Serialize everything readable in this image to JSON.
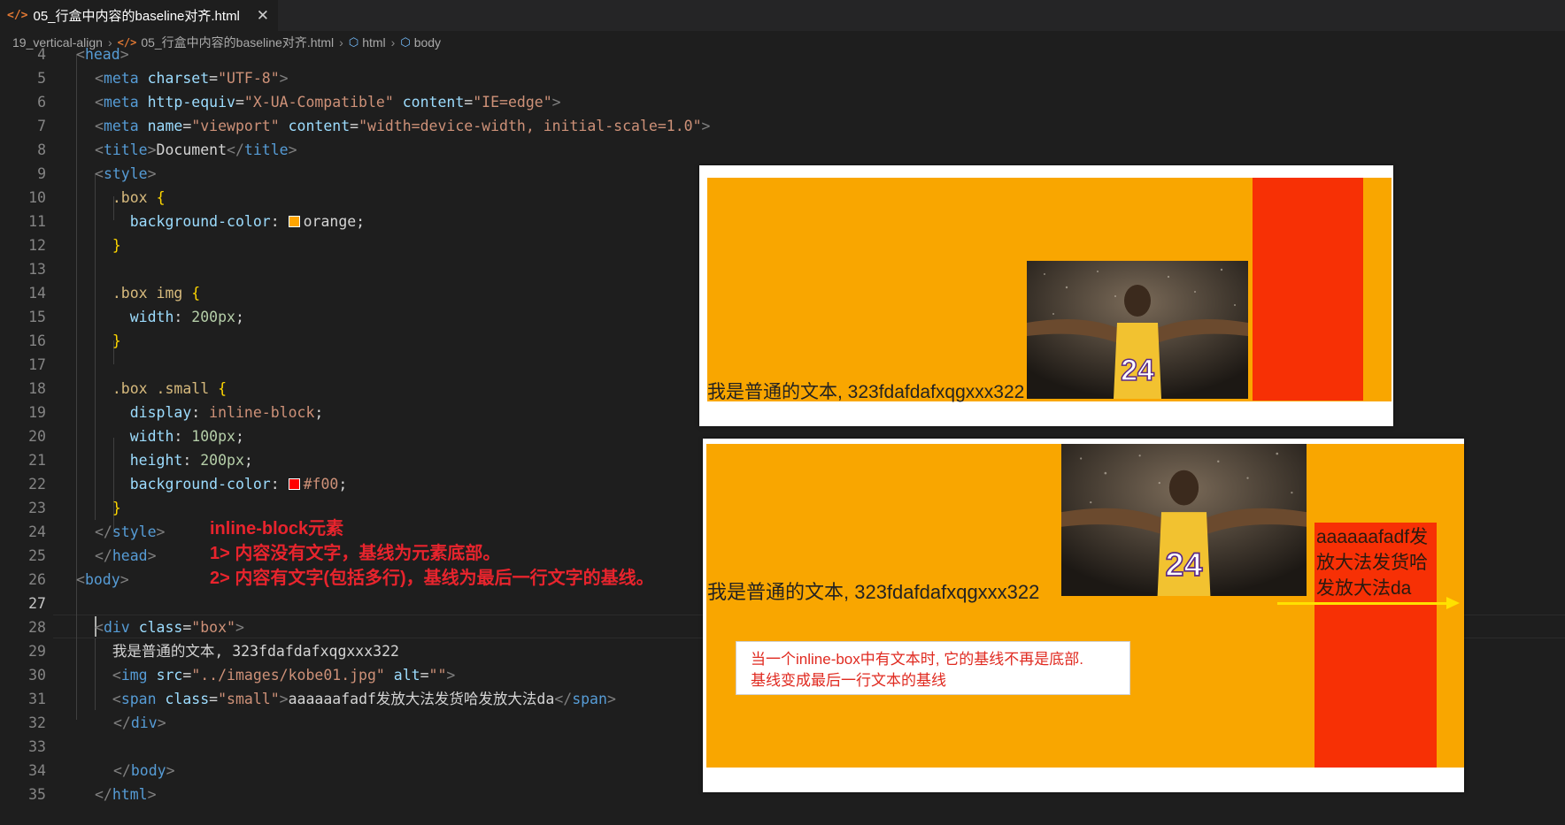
{
  "tab": {
    "icon": "</>",
    "title": "05_行盒中内容的baseline对齐.html",
    "close": "✕"
  },
  "breadcrumb": {
    "folder": "19_vertical-align",
    "file": "05_行盒中内容的baseline对齐.html",
    "html": "html",
    "body": "body"
  },
  "code_lines": [
    {
      "n": "4",
      "tokens": [
        [
          "t-br",
          "<"
        ],
        [
          "t-tag",
          "head"
        ],
        [
          "t-br",
          ">"
        ]
      ]
    },
    {
      "n": "5",
      "tokens": [
        [
          "t-br",
          "<"
        ],
        [
          "t-tag",
          "meta"
        ],
        [
          "t-text",
          " "
        ],
        [
          "t-attr",
          "charset"
        ],
        [
          "t-text",
          "="
        ],
        [
          "t-str",
          "\"UTF-8\""
        ],
        [
          "t-br",
          ">"
        ]
      ]
    },
    {
      "n": "6",
      "tokens": [
        [
          "t-br",
          "<"
        ],
        [
          "t-tag",
          "meta"
        ],
        [
          "t-text",
          " "
        ],
        [
          "t-attr",
          "http-equiv"
        ],
        [
          "t-text",
          "="
        ],
        [
          "t-str",
          "\"X-UA-Compatible\""
        ],
        [
          "t-text",
          " "
        ],
        [
          "t-attr",
          "content"
        ],
        [
          "t-text",
          "="
        ],
        [
          "t-str",
          "\"IE=edge\""
        ],
        [
          "t-br",
          ">"
        ]
      ]
    },
    {
      "n": "7",
      "tokens": [
        [
          "t-br",
          "<"
        ],
        [
          "t-tag",
          "meta"
        ],
        [
          "t-text",
          " "
        ],
        [
          "t-attr",
          "name"
        ],
        [
          "t-text",
          "="
        ],
        [
          "t-str",
          "\"viewport\""
        ],
        [
          "t-text",
          " "
        ],
        [
          "t-attr",
          "content"
        ],
        [
          "t-text",
          "="
        ],
        [
          "t-str",
          "\"width=device-width, initial-scale=1.0\""
        ],
        [
          "t-br",
          ">"
        ]
      ]
    },
    {
      "n": "8",
      "tokens": [
        [
          "t-br",
          "<"
        ],
        [
          "t-tag",
          "title"
        ],
        [
          "t-br",
          ">"
        ],
        [
          "t-text",
          "Document"
        ],
        [
          "t-br",
          "</"
        ],
        [
          "t-tag",
          "title"
        ],
        [
          "t-br",
          ">"
        ]
      ]
    },
    {
      "n": "9",
      "tokens": [
        [
          "t-br",
          "<"
        ],
        [
          "t-tag",
          "style"
        ],
        [
          "t-br",
          ">"
        ]
      ]
    },
    {
      "n": "10",
      "tokens": [
        [
          "t-text",
          "  "
        ],
        [
          "t-sel",
          ".box"
        ],
        [
          "t-text",
          " "
        ],
        [
          "t-brace",
          "{"
        ]
      ]
    },
    {
      "n": "11",
      "tokens": [
        [
          "t-text",
          "    "
        ],
        [
          "t-prop",
          "background-color"
        ],
        [
          "t-text",
          ": "
        ],
        [
          "swatch",
          "#ffa500"
        ],
        [
          "t-text",
          "orange;"
        ]
      ]
    },
    {
      "n": "12",
      "tokens": [
        [
          "t-text",
          "  "
        ],
        [
          "t-brace",
          "}"
        ]
      ]
    },
    {
      "n": "13",
      "tokens": []
    },
    {
      "n": "14",
      "tokens": [
        [
          "t-text",
          "  "
        ],
        [
          "t-sel",
          ".box img"
        ],
        [
          "t-text",
          " "
        ],
        [
          "t-brace",
          "{"
        ]
      ]
    },
    {
      "n": "15",
      "tokens": [
        [
          "t-text",
          "    "
        ],
        [
          "t-prop",
          "width"
        ],
        [
          "t-text",
          ": "
        ],
        [
          "t-num",
          "200px"
        ],
        [
          "t-text",
          ";"
        ]
      ]
    },
    {
      "n": "16",
      "tokens": [
        [
          "t-text",
          "  "
        ],
        [
          "t-brace",
          "}"
        ]
      ]
    },
    {
      "n": "17",
      "tokens": []
    },
    {
      "n": "18",
      "tokens": [
        [
          "t-text",
          "  "
        ],
        [
          "t-sel",
          ".box .small"
        ],
        [
          "t-text",
          " "
        ],
        [
          "t-brace",
          "{"
        ]
      ]
    },
    {
      "n": "19",
      "tokens": [
        [
          "t-text",
          "    "
        ],
        [
          "t-prop",
          "display"
        ],
        [
          "t-text",
          ": "
        ],
        [
          "t-str",
          "inline-block"
        ],
        [
          "t-text",
          ";"
        ]
      ]
    },
    {
      "n": "20",
      "tokens": [
        [
          "t-text",
          "    "
        ],
        [
          "t-prop",
          "width"
        ],
        [
          "t-text",
          ": "
        ],
        [
          "t-num",
          "100px"
        ],
        [
          "t-text",
          ";"
        ]
      ]
    },
    {
      "n": "21",
      "tokens": [
        [
          "t-text",
          "    "
        ],
        [
          "t-prop",
          "height"
        ],
        [
          "t-text",
          ": "
        ],
        [
          "t-num",
          "200px"
        ],
        [
          "t-text",
          ";"
        ]
      ]
    },
    {
      "n": "22",
      "tokens": [
        [
          "t-text",
          "    "
        ],
        [
          "t-prop",
          "background-color"
        ],
        [
          "t-text",
          ": "
        ],
        [
          "swatch",
          "#ff0000"
        ],
        [
          "t-str",
          "#f00"
        ],
        [
          "t-text",
          ";"
        ]
      ]
    },
    {
      "n": "23",
      "tokens": [
        [
          "t-text",
          "  "
        ],
        [
          "t-brace",
          "}"
        ]
      ]
    },
    {
      "n": "24",
      "tokens": [
        [
          "t-br",
          "</"
        ],
        [
          "t-tag",
          "style"
        ],
        [
          "t-br",
          ">"
        ]
      ]
    },
    {
      "n": "25",
      "tokens": [
        [
          "t-br",
          "</"
        ],
        [
          "t-tag",
          "head"
        ],
        [
          "t-br",
          ">"
        ]
      ]
    },
    {
      "n": "26",
      "tokens": [
        [
          "t-br",
          "<"
        ],
        [
          "t-tag",
          "body"
        ],
        [
          "t-br",
          ">"
        ]
      ]
    },
    {
      "n": "27",
      "tokens": []
    },
    {
      "n": "28",
      "tokens": [
        [
          "t-br",
          "<"
        ],
        [
          "t-tag",
          "div"
        ],
        [
          "t-text",
          " "
        ],
        [
          "t-attr",
          "class"
        ],
        [
          "t-text",
          "="
        ],
        [
          "t-str",
          "\"box\""
        ],
        [
          "t-br",
          ">"
        ]
      ]
    },
    {
      "n": "29",
      "tokens": [
        [
          "t-text",
          "  我是普通的文本, 323fdafdafxqgxxx322"
        ]
      ]
    },
    {
      "n": "30",
      "tokens": [
        [
          "t-text",
          "  "
        ],
        [
          "t-br",
          "<"
        ],
        [
          "t-tag",
          "img"
        ],
        [
          "t-text",
          " "
        ],
        [
          "t-attr",
          "src"
        ],
        [
          "t-text",
          "="
        ],
        [
          "t-str",
          "\"../images/kobe01.jpg\""
        ],
        [
          "t-text",
          " "
        ],
        [
          "t-attr",
          "alt"
        ],
        [
          "t-text",
          "="
        ],
        [
          "t-str",
          "\"\""
        ],
        [
          "t-br",
          ">"
        ]
      ]
    },
    {
      "n": "31",
      "tokens": [
        [
          "t-text",
          "  "
        ],
        [
          "t-br",
          "<"
        ],
        [
          "t-tag",
          "span"
        ],
        [
          "t-text",
          " "
        ],
        [
          "t-attr",
          "class"
        ],
        [
          "t-text",
          "="
        ],
        [
          "t-str",
          "\"small\""
        ],
        [
          "t-br",
          ">"
        ],
        [
          "t-text",
          "aaaaaafadf发放大法发货哈发放大法da"
        ],
        [
          "t-br",
          "</"
        ],
        [
          "t-tag",
          "span"
        ],
        [
          "t-br",
          ">"
        ]
      ]
    },
    {
      "n": "32",
      "tokens": [
        [
          "t-br",
          "</"
        ],
        [
          "t-tag",
          "div"
        ],
        [
          "t-br",
          ">"
        ]
      ]
    },
    {
      "n": "33",
      "tokens": []
    },
    {
      "n": "34",
      "tokens": [
        [
          "t-br",
          "</"
        ],
        [
          "t-tag",
          "body"
        ],
        [
          "t-br",
          ">"
        ]
      ]
    },
    {
      "n": "35",
      "tokens": [
        [
          "t-br",
          "</"
        ],
        [
          "t-tag",
          "html"
        ],
        [
          "t-br",
          ">"
        ]
      ]
    }
  ],
  "active_line": "27",
  "annotation": {
    "title": "inline-block元素",
    "line1": "1> 内容没有文字，基线为元素底部。",
    "line2": "2> 内容有文字(包括多行)，基线为最后一行文字的基线。"
  },
  "preview1": {
    "text": "我是普通的文本, 323fdafdafxqgxxx322",
    "image_icon": "basketball-player-photo"
  },
  "preview2": {
    "text": "我是普通的文本, 323fdafdafxqgxxx322",
    "image_icon": "basketball-player-photo",
    "small_text": "aaaaaafadf发放大法发货哈发放大法da",
    "note_line1": "当一个inline-box中有文本时, 它的基线不再是底部.",
    "note_line2": "基线变成最后一行文本的基线"
  },
  "colors": {
    "orange_box": "#f9a600",
    "red_box": "#f73005",
    "annotation": "#e8242d",
    "arrow": "#ffe100"
  }
}
